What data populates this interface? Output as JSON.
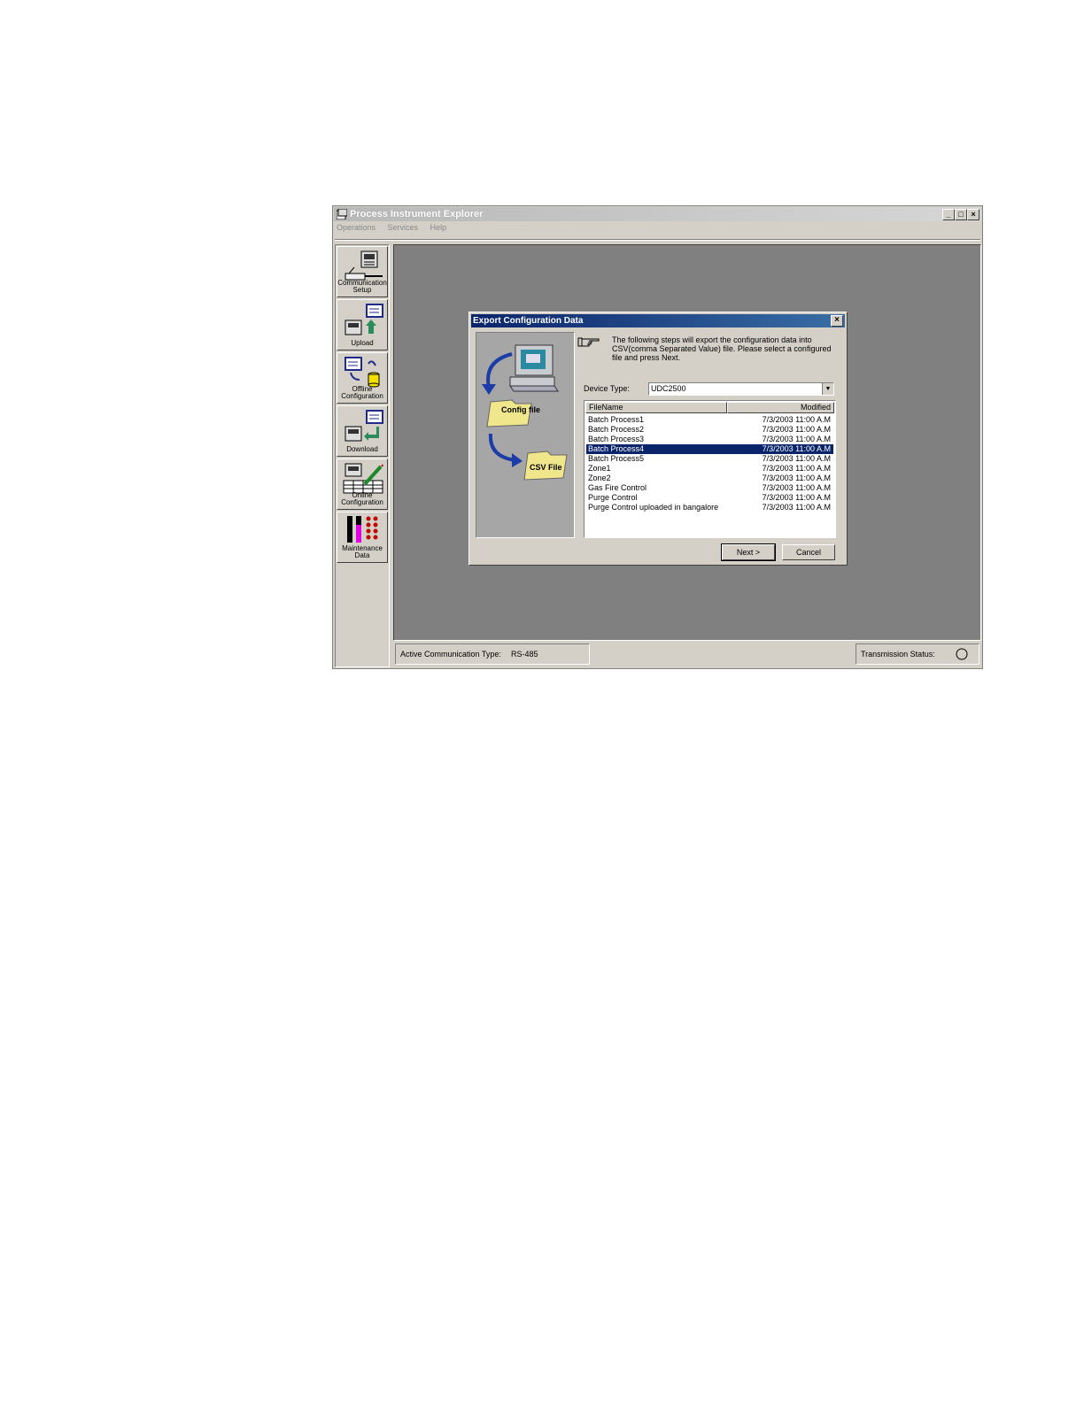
{
  "app": {
    "title": "Process Instrument Explorer",
    "menu": [
      "Operations",
      "Services",
      "Help"
    ],
    "window_buttons": {
      "minimize": "_",
      "maximize": "□",
      "close": "×"
    }
  },
  "sidebar": {
    "items": [
      {
        "label": "Communication Setup",
        "icon": "communication-setup-icon"
      },
      {
        "label": "Upload",
        "icon": "upload-icon"
      },
      {
        "label": "Offline Configuration",
        "icon": "offline-configuration-icon"
      },
      {
        "label": "Download",
        "icon": "download-icon"
      },
      {
        "label": "Online Configuration",
        "icon": "online-configuration-icon"
      },
      {
        "label": "Maintenance Data",
        "icon": "maintenance-data-icon"
      }
    ]
  },
  "status": {
    "comm_label": "Active Communication Type:",
    "comm_value": "RS-485",
    "transmission_label": "Transmission Status:"
  },
  "dialog": {
    "title": "Export Configuration Data",
    "close": "×",
    "instructions": "The following steps will export the configuration data into CSV(comma Separated  Value) file. Please select a configured file and press Next.",
    "illustration": {
      "config_label": "Config file",
      "csv_label": "CSV File"
    },
    "device_type_label": "Device Type:",
    "device_type_value": "UDC2500",
    "columns": {
      "name": "FileName",
      "modified": "Modified"
    },
    "files": [
      {
        "name": "Batch Process1",
        "modified": "7/3/2003 11:00 A.M"
      },
      {
        "name": "Batch Process2",
        "modified": "7/3/2003 11:00 A.M"
      },
      {
        "name": "Batch Process3",
        "modified": "7/3/2003 11:00 A.M"
      },
      {
        "name": "Batch Process4",
        "modified": "7/3/2003 11:00 A.M"
      },
      {
        "name": "Batch Process5",
        "modified": "7/3/2003 11:00 A.M"
      },
      {
        "name": "Zone1",
        "modified": "7/3/2003 11:00 A.M"
      },
      {
        "name": "Zone2",
        "modified": "7/3/2003 11:00 A.M"
      },
      {
        "name": "Gas Fire Control",
        "modified": "7/3/2003 11:00 A.M"
      },
      {
        "name": "Purge Control",
        "modified": "7/3/2003 11:00 A.M"
      },
      {
        "name": "Purge Control uploaded in bangalore",
        "modified": "7/3/2003 11:00 A.M"
      }
    ],
    "selected_file": "Batch Process4",
    "next_label": "Next >",
    "cancel_label": "Cancel"
  },
  "colors": {
    "selection": "#0a246a",
    "title_active": "#0a246a",
    "workspace": "#808080",
    "face": "#d4d0c8"
  }
}
